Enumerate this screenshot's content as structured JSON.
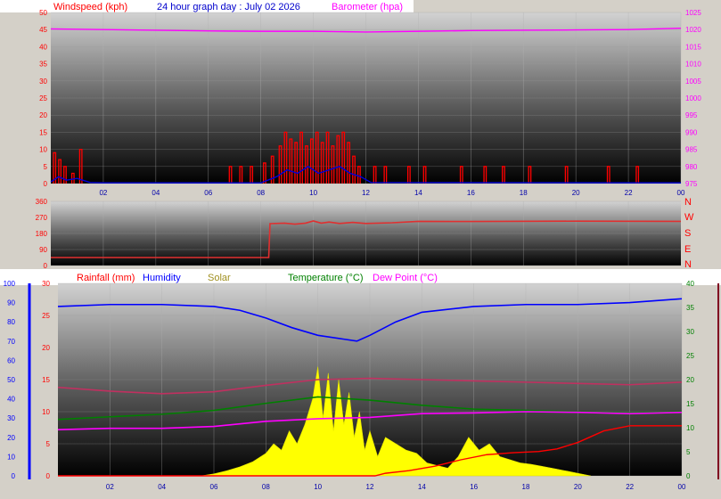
{
  "colors": {
    "wind": "#ff0000",
    "gust": "#0000dd",
    "baro": "#ff00ff",
    "dir": "#e03030",
    "rain": "#ff0000",
    "humidity": "#0000ff",
    "solar": "#ffff00",
    "temperature": "#008000",
    "dewpoint": "#ff00ff",
    "feels": "#c03060",
    "header_text": "#0000cc"
  },
  "chart_data": [
    {
      "type": "line",
      "panel": "wind-baro",
      "title": "24 hour graph day : July 02 2026",
      "ylabel": "Windspeed (kph)",
      "y2label": "Barometer (hpa)",
      "x_tick_labels": [
        "02",
        "04",
        "06",
        "08",
        "10",
        "12",
        "14",
        "16",
        "18",
        "20",
        "22",
        "00"
      ],
      "ylim": [
        0,
        50
      ],
      "y_ticks": [
        0,
        5,
        10,
        15,
        20,
        25,
        30,
        35,
        40,
        45,
        50
      ],
      "y2lim": [
        975,
        1025
      ],
      "y2_ticks": [
        975,
        980,
        985,
        990,
        995,
        1000,
        1005,
        1010,
        1015,
        1020,
        1025
      ],
      "barometer_hours": [
        0,
        2,
        4,
        6,
        8,
        10,
        12,
        14,
        16,
        18,
        20,
        22,
        24
      ],
      "barometer_values": [
        1020.2,
        1020.0,
        1019.8,
        1019.6,
        1019.5,
        1019.5,
        1019.3,
        1019.5,
        1019.7,
        1019.8,
        1019.9,
        1020.0,
        1020.4
      ],
      "wind_spikes": [
        [
          0.1,
          9
        ],
        [
          0.3,
          7
        ],
        [
          0.5,
          5
        ],
        [
          0.8,
          3
        ],
        [
          1.1,
          10
        ],
        [
          6.8,
          5
        ],
        [
          7.2,
          5
        ],
        [
          7.6,
          5
        ],
        [
          8.1,
          6
        ],
        [
          8.4,
          8
        ],
        [
          8.7,
          11
        ],
        [
          8.9,
          15
        ],
        [
          9.1,
          13
        ],
        [
          9.3,
          12
        ],
        [
          9.5,
          15
        ],
        [
          9.7,
          11
        ],
        [
          9.9,
          13
        ],
        [
          10.1,
          15
        ],
        [
          10.3,
          12
        ],
        [
          10.5,
          15
        ],
        [
          10.7,
          11
        ],
        [
          10.9,
          14
        ],
        [
          11.1,
          15
        ],
        [
          11.3,
          12
        ],
        [
          11.5,
          8
        ],
        [
          11.7,
          5
        ],
        [
          12.3,
          5
        ],
        [
          12.7,
          5
        ],
        [
          13.6,
          5
        ],
        [
          14.2,
          5
        ],
        [
          15.6,
          5
        ],
        [
          16.5,
          5
        ],
        [
          17.2,
          5
        ],
        [
          18.2,
          5
        ],
        [
          19.6,
          5
        ],
        [
          21.2,
          5
        ],
        [
          22.3,
          5
        ]
      ],
      "gust_hours": [
        0,
        0.3,
        0.6,
        1.0,
        1.5,
        2,
        8,
        8.6,
        9.0,
        9.4,
        9.8,
        10.2,
        10.6,
        11.0,
        11.4,
        11.8,
        12.2,
        24
      ],
      "gust_values": [
        0.5,
        2,
        1,
        1.5,
        0.3,
        0.2,
        0.2,
        2,
        4,
        3,
        5,
        3,
        4,
        5,
        3,
        2,
        0.3,
        0.2
      ]
    },
    {
      "type": "line",
      "panel": "wind-direction",
      "ylim": [
        0,
        360
      ],
      "y_ticks": [
        0,
        90,
        180,
        270,
        360
      ],
      "compass_labels": [
        "N",
        "W",
        "S",
        "E",
        "N"
      ],
      "direction_hours": [
        0,
        8.3,
        8.35,
        8.9,
        9.3,
        9.7,
        10.0,
        10.3,
        10.6,
        11.0,
        11.5,
        12.0,
        13.0,
        14.0,
        16.0,
        20.0,
        24.0
      ],
      "direction_values": [
        45,
        45,
        235,
        238,
        232,
        238,
        250,
        238,
        244,
        236,
        242,
        236,
        240,
        248,
        247,
        249,
        248
      ]
    },
    {
      "type": "line",
      "panel": "rain-humidity-temperature",
      "legend": [
        "Rainfall (mm)",
        "Humidity",
        "Solar",
        "Temperature (°C)",
        "Dew Point (°C)"
      ],
      "x_tick_labels": [
        "02",
        "04",
        "06",
        "08",
        "10",
        "12",
        "14",
        "16",
        "18",
        "20",
        "22",
        "00"
      ],
      "ylim": [
        0,
        30
      ],
      "y_ticks": [
        0,
        5,
        10,
        15,
        20,
        25,
        30
      ],
      "humidity_ylim": [
        0,
        100
      ],
      "humidity_ticks": [
        0,
        10,
        20,
        30,
        40,
        50,
        60,
        70,
        80,
        90,
        100
      ],
      "temperature_ylim": [
        0,
        40
      ],
      "temperature_ticks": [
        0,
        5,
        10,
        15,
        20,
        25,
        30,
        35,
        40
      ],
      "humidity_hours": [
        0,
        2,
        4,
        6,
        7,
        8,
        9,
        10,
        11,
        11.5,
        12,
        13,
        14,
        16,
        18,
        20,
        22,
        24
      ],
      "humidity_values": [
        88,
        89,
        89,
        88,
        86,
        82,
        77,
        73,
        71,
        70,
        73,
        80,
        85,
        88,
        89,
        89,
        90,
        92
      ],
      "temperature_hours": [
        0,
        2,
        4,
        6,
        8,
        10,
        12,
        14,
        16,
        18,
        20,
        22,
        24
      ],
      "temperature_values": [
        8.8,
        9.2,
        9.6,
        10.2,
        11.3,
        12.3,
        11.8,
        11.0,
        10.4,
        10.2,
        10.0,
        9.8,
        10.0
      ],
      "feels_like_hours": [
        0,
        2,
        4,
        6,
        8,
        10,
        12,
        14,
        16,
        18,
        20,
        22,
        24
      ],
      "feels_like_values": [
        13.8,
        13.2,
        12.8,
        13.1,
        14.1,
        15.0,
        15.2,
        15.0,
        14.8,
        14.6,
        14.4,
        14.2,
        14.6
      ],
      "dewpoint_hours": [
        0,
        2,
        4,
        6,
        7,
        8,
        10,
        12,
        13,
        14,
        16,
        18,
        20,
        22,
        24
      ],
      "dewpoint_values": [
        7.2,
        7.4,
        7.4,
        7.7,
        8.1,
        8.5,
        8.9,
        9.1,
        9.4,
        9.7,
        9.8,
        10.0,
        9.9,
        9.7,
        9.9
      ],
      "rainfall_hours": [
        0,
        12.2,
        12.6,
        13.5,
        14.5,
        15.5,
        16.5,
        17.5,
        18.5,
        19.2,
        20.0,
        21.0,
        22.0,
        24.0
      ],
      "rainfall_values": [
        0,
        0,
        0.4,
        0.8,
        1.5,
        2.5,
        3.3,
        3.6,
        3.8,
        4.2,
        5.2,
        7.0,
        7.8,
        7.8
      ],
      "solar_hours": [
        5.5,
        6.0,
        6.5,
        7.0,
        7.5,
        8.0,
        8.3,
        8.6,
        8.9,
        9.2,
        9.5,
        9.8,
        10.0,
        10.2,
        10.4,
        10.6,
        10.8,
        11.0,
        11.2,
        11.4,
        11.6,
        11.8,
        12.0,
        12.3,
        12.6,
        13.0,
        13.4,
        13.8,
        14.2,
        14.6,
        15.0,
        15.4,
        15.8,
        16.2,
        16.6,
        17.0,
        17.4,
        17.8,
        18.2,
        18.6,
        19.0,
        19.5,
        20.0,
        20.5
      ],
      "solar_values": [
        0,
        0.3,
        0.8,
        1.4,
        2.2,
        3.5,
        5,
        4,
        7,
        5,
        8,
        12,
        17,
        9,
        16,
        7,
        15,
        8,
        13,
        6,
        10,
        4,
        7,
        3,
        6,
        5,
        4,
        3.5,
        2,
        1.6,
        1.2,
        3,
        6,
        4,
        5,
        3,
        2.5,
        2,
        1.8,
        1.5,
        1.2,
        0.8,
        0.4,
        0
      ]
    }
  ]
}
